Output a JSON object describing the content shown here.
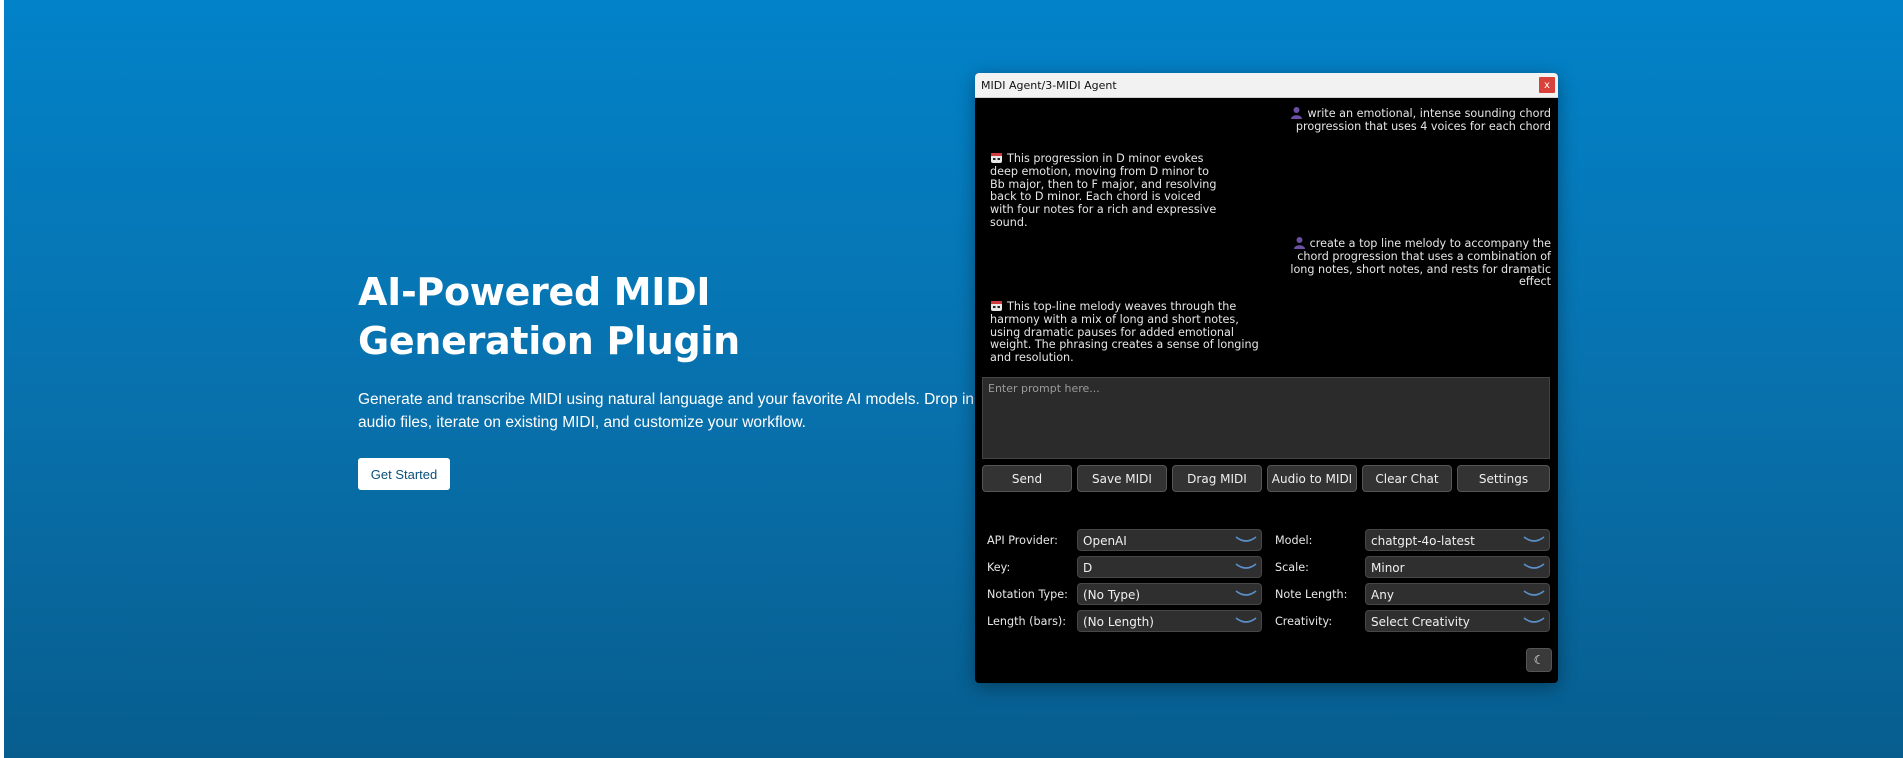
{
  "hero": {
    "title": "AI-Powered MIDI Generation Plugin",
    "subtitle": "Generate and transcribe MIDI using natural language and your favorite AI models. Drop in audio files, iterate on existing MIDI, and customize your workflow.",
    "cta_label": "Get Started"
  },
  "window": {
    "title": "MIDI Agent/3-MIDI Agent",
    "close_label": "x"
  },
  "chat": {
    "messages": [
      {
        "role": "user",
        "icon": "user-icon",
        "text": "write an emotional, intense sounding chord progression that uses 4 voices for each chord"
      },
      {
        "role": "assistant",
        "icon": "robot-icon",
        "text": "This progression in D minor evokes deep emotion, moving from D minor to Bb major, then to F major, and resolving back to D minor. Each chord is voiced with four notes for a rich and expressive sound."
      },
      {
        "role": "user",
        "icon": "user-icon",
        "text": "create a top line melody to accompany the chord progression that uses a combination of long notes, short notes, and rests for dramatic effect"
      },
      {
        "role": "assistant",
        "icon": "robot-icon",
        "text": "This top-line melody weaves through the harmony with a mix of long and short notes, using dramatic pauses for added emotional weight. The phrasing creates a sense of longing and resolution."
      }
    ]
  },
  "prompt": {
    "placeholder": "Enter prompt here...",
    "value": ""
  },
  "actions": {
    "send": "Send",
    "save_midi": "Save MIDI",
    "drag_midi": "Drag MIDI",
    "audio_to_midi": "Audio to MIDI",
    "clear_chat": "Clear Chat",
    "settings": "Settings"
  },
  "settings": {
    "api_provider": {
      "label": "API Provider:",
      "value": "OpenAI"
    },
    "model": {
      "label": "Model:",
      "value": "chatgpt-4o-latest"
    },
    "key": {
      "label": "Key:",
      "value": "D"
    },
    "scale": {
      "label": "Scale:",
      "value": "Minor"
    },
    "notation_type": {
      "label": "Notation Type:",
      "value": "(No Type)"
    },
    "note_length": {
      "label": "Note Length:",
      "value": "Any"
    },
    "length_bars": {
      "label": "Length (bars):",
      "value": "(No Length)"
    },
    "creativity": {
      "label": "Creativity:",
      "value": "Select Creativity"
    }
  },
  "theme_toggle": {
    "label": "☾",
    "icon": "moon-icon"
  },
  "colors": {
    "hero_top": "#0282c9",
    "hero_bottom": "#075d8e",
    "window_bg": "#000000",
    "button_bg": "#333333",
    "close_red": "#d9423b",
    "chevron_blue": "#5b8fc9"
  }
}
